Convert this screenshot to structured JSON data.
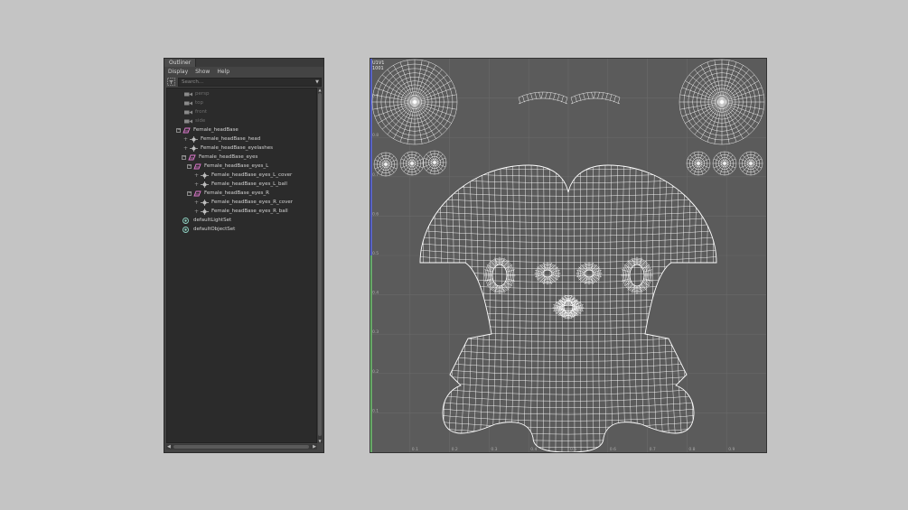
{
  "outliner": {
    "title": "Outliner",
    "menu": [
      "Display",
      "Show",
      "Help"
    ],
    "search_placeholder": "Search...",
    "items": [
      {
        "label": "persp",
        "icon": "camera-icon",
        "dim": true
      },
      {
        "label": "top",
        "icon": "camera-icon",
        "dim": true
      },
      {
        "label": "front",
        "icon": "camera-icon",
        "dim": true
      },
      {
        "label": "side",
        "icon": "camera-icon",
        "dim": true
      },
      {
        "label": "Female_headBase",
        "icon": "group-icon"
      },
      {
        "label": "Female_headBase_head",
        "icon": "mesh-icon"
      },
      {
        "label": "Female_headBase_eyelashes",
        "icon": "mesh-icon"
      },
      {
        "label": "Female_headBase_eyes",
        "icon": "group-icon"
      },
      {
        "label": "Female_headBase_eyes_L",
        "icon": "group-icon"
      },
      {
        "label": "Female_headBase_eyes_L_cover",
        "icon": "mesh-icon"
      },
      {
        "label": "Female_headBase_eyes_L_ball",
        "icon": "mesh-icon"
      },
      {
        "label": "Female_headBase_eyes_R",
        "icon": "group-icon"
      },
      {
        "label": "Female_headBase_eyes_R_cover",
        "icon": "mesh-icon"
      },
      {
        "label": "Female_headBase_eyes_R_ball",
        "icon": "mesh-icon"
      },
      {
        "label": "defaultLightSet",
        "icon": "set-icon"
      },
      {
        "label": "defaultObjectSet",
        "icon": "set-icon"
      }
    ]
  },
  "uv_editor": {
    "tile_label_1": "U1V1",
    "tile_label_2": "1001",
    "u_ticks": [
      "0.1",
      "0.2",
      "0.3",
      "0.4",
      "0.5",
      "0.6",
      "0.7",
      "0.8",
      "0.9"
    ],
    "v_ticks": [
      "0.9",
      "0.8",
      "0.7",
      "0.6",
      "0.5",
      "0.4",
      "0.3",
      "0.2",
      "0.1"
    ],
    "colors": {
      "background": "#5b5b5b",
      "grid": "#6a6a6a",
      "wire": "#ffffff",
      "u_axis": "#6fd36f",
      "v_axis": "#5a6bff"
    }
  }
}
